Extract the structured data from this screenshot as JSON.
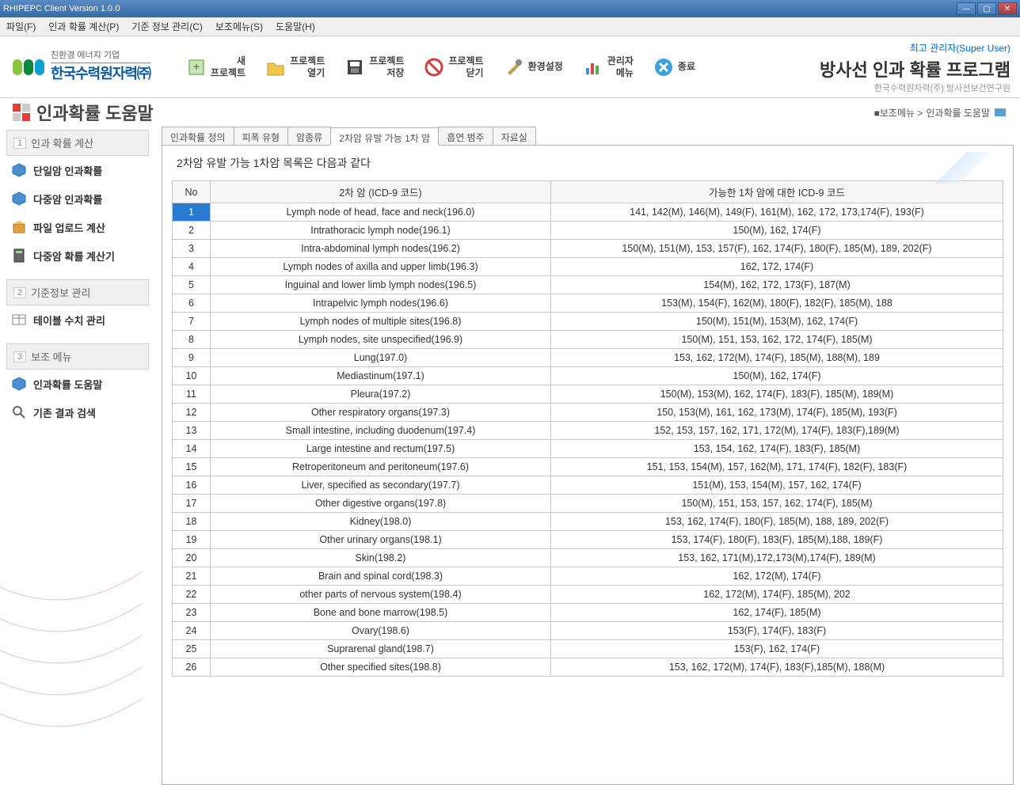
{
  "window": {
    "title": "RHIPEPC Client Version 1.0.0"
  },
  "menubar": {
    "items": [
      "파일(F)",
      "인과 확률 계산(P)",
      "기준 정보 관리(C)",
      "보조메뉴(S)",
      "도움말(H)"
    ]
  },
  "logo": {
    "sub": "친환경 에너지 기업",
    "main": "한국수력원자력㈜"
  },
  "toolbar": {
    "new_project": "새\n프로젝트",
    "open_project": "프로젝트\n열기",
    "save_project": "프로젝트\n저장",
    "close_project": "프로젝트\n닫기",
    "env_settings": "환경설정",
    "admin_menu": "관리자\n메뉴",
    "exit": "종료"
  },
  "header": {
    "admin": "최고 관리자(Super User)",
    "title": "방사선 인과 확률 프로그램",
    "subtitle": "한국수력원자력(주) 방사선보건연구원"
  },
  "page": {
    "title": "인과확률 도움말",
    "breadcrumb_pre": "■보조메뉴 >",
    "breadcrumb_cur": "인과확률 도움말"
  },
  "sidebar": {
    "g1": {
      "num": "1",
      "label": "인과 확률 계산",
      "items": [
        "단일암 인과확률",
        "다중암 인과확률",
        "파일 업로드 계산",
        "다중암 확률 계산기"
      ]
    },
    "g2": {
      "num": "2",
      "label": "기준정보 관리",
      "items": [
        "테이블 수치 관리"
      ]
    },
    "g3": {
      "num": "3",
      "label": "보조 메뉴",
      "items": [
        "인과확률 도움말",
        "기존 결과 검색"
      ]
    }
  },
  "tabs": {
    "items": [
      "인과확률 정의",
      "피폭 유형",
      "암종류",
      "2차암 유발 가능 1차 암",
      "흡연 범주",
      "자료실"
    ],
    "active": 3
  },
  "content_head": "2차암 유발 가능 1차암 목록은 다음과 같다",
  "table": {
    "headers": {
      "no": "No",
      "name": "2차 암 (ICD-9 코드)",
      "codes": "가능한 1차 암에 대한 ICD-9 코드"
    },
    "rows": [
      {
        "no": "1",
        "name": "Lymph node of head, face and neck(196.0)",
        "codes": "141, 142(M), 146(M), 149(F), 161(M), 162, 172, 173,174(F), 193(F)"
      },
      {
        "no": "2",
        "name": "Intrathoracic lymph node(196.1)",
        "codes": "150(M), 162, 174(F)"
      },
      {
        "no": "3",
        "name": "Intra-abdominal lymph nodes(196.2)",
        "codes": "150(M), 151(M), 153, 157(F), 162, 174(F), 180(F), 185(M), 189, 202(F)"
      },
      {
        "no": "4",
        "name": "Lymph nodes of axilla and upper limb(196.3)",
        "codes": "162, 172, 174(F)"
      },
      {
        "no": "5",
        "name": "Inguinal and lower limb lymph nodes(196.5)",
        "codes": "154(M), 162, 172, 173(F), 187(M)"
      },
      {
        "no": "6",
        "name": "Intrapelvic lymph nodes(196.6)",
        "codes": "153(M), 154(F), 162(M), 180(F), 182(F), 185(M), 188"
      },
      {
        "no": "7",
        "name": "Lymph nodes of multiple sites(196.8)",
        "codes": "150(M), 151(M), 153(M), 162, 174(F)"
      },
      {
        "no": "8",
        "name": "Lymph nodes, site unspecified(196.9)",
        "codes": "150(M), 151, 153, 162, 172, 174(F), 185(M)"
      },
      {
        "no": "9",
        "name": "Lung(197.0)",
        "codes": "153, 162, 172(M), 174(F), 185(M), 188(M), 189"
      },
      {
        "no": "10",
        "name": "Mediastinum(197.1)",
        "codes": "150(M), 162, 174(F)"
      },
      {
        "no": "11",
        "name": "Pleura(197.2)",
        "codes": "150(M), 153(M), 162, 174(F), 183(F), 185(M), 189(M)"
      },
      {
        "no": "12",
        "name": "Other respiratory organs(197.3)",
        "codes": "150, 153(M), 161, 162, 173(M), 174(F), 185(M), 193(F)"
      },
      {
        "no": "13",
        "name": "Small intestine, including duodenum(197.4)",
        "codes": "152, 153, 157, 162, 171, 172(M), 174(F), 183(F),189(M)"
      },
      {
        "no": "14",
        "name": "Large intestine and rectum(197.5)",
        "codes": "153, 154, 162, 174(F), 183(F), 185(M)"
      },
      {
        "no": "15",
        "name": "Retroperitoneum and peritoneum(197.6)",
        "codes": "151, 153, 154(M), 157, 162(M), 171, 174(F), 182(F), 183(F)"
      },
      {
        "no": "16",
        "name": "Liver, specified as secondary(197.7)",
        "codes": "151(M), 153, 154(M), 157, 162, 174(F)"
      },
      {
        "no": "17",
        "name": "Other digestive organs(197.8)",
        "codes": "150(M), 151, 153, 157, 162, 174(F), 185(M)"
      },
      {
        "no": "18",
        "name": "Kidney(198.0)",
        "codes": "153, 162, 174(F), 180(F), 185(M), 188, 189, 202(F)"
      },
      {
        "no": "19",
        "name": "Other urinary organs(198.1)",
        "codes": "153, 174(F), 180(F), 183(F), 185(M),188, 189(F)"
      },
      {
        "no": "20",
        "name": "Skin(198.2)",
        "codes": "153, 162, 171(M),172,173(M),174(F), 189(M)"
      },
      {
        "no": "21",
        "name": "Brain and spinal cord(198.3)",
        "codes": "162, 172(M), 174(F)"
      },
      {
        "no": "22",
        "name": "other parts of nervous system(198.4)",
        "codes": "162, 172(M), 174(F), 185(M), 202"
      },
      {
        "no": "23",
        "name": "Bone and bone marrow(198.5)",
        "codes": "162, 174(F), 185(M)"
      },
      {
        "no": "24",
        "name": "Ovary(198.6)",
        "codes": "153(F), 174(F), 183(F)"
      },
      {
        "no": "25",
        "name": "Suprarenal gland(198.7)",
        "codes": "153(F), 162, 174(F)"
      },
      {
        "no": "26",
        "name": "Other specified sites(198.8)",
        "codes": "153, 162, 172(M), 174(F), 183(F),185(M), 188(M)"
      }
    ]
  },
  "colors": {
    "logo1": "#8bc540",
    "logo2": "#0a8a3a",
    "logo3": "#0aa0d0",
    "accent": "#2a7ad0"
  }
}
